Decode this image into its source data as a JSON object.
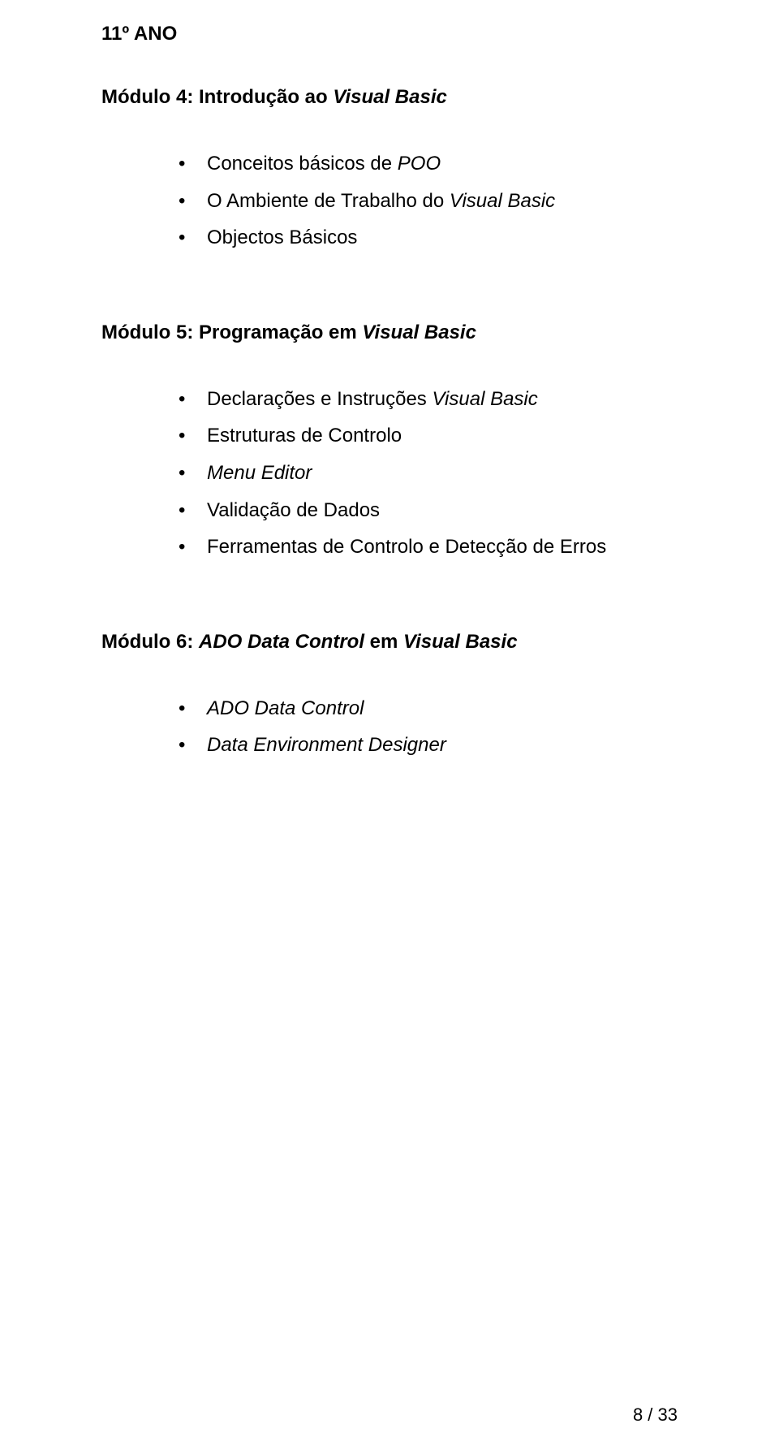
{
  "year_heading": "11º ANO",
  "module4": {
    "title_prefix": "Módulo 4: Introdução ao ",
    "title_italic": "Visual Basic",
    "items": [
      {
        "prefix": "Conceitos básicos de ",
        "italic": "POO"
      },
      {
        "prefix": "O Ambiente de Trabalho do ",
        "italic": "Visual Basic"
      },
      {
        "prefix": "Objectos Básicos",
        "italic": ""
      }
    ]
  },
  "module5": {
    "title_prefix": "Módulo 5: Programação em ",
    "title_italic": "Visual Basic",
    "items": [
      {
        "prefix": "Declarações e Instruções ",
        "italic": "Visual Basic"
      },
      {
        "prefix": "Estruturas de Controlo",
        "italic": ""
      },
      {
        "prefix": "",
        "italic": "Menu Editor"
      },
      {
        "prefix": "Validação de Dados",
        "italic": ""
      },
      {
        "prefix": "Ferramentas de Controlo e Detecção de Erros",
        "italic": ""
      }
    ]
  },
  "module6": {
    "title_prefix": "Módulo 6: ",
    "title_italic": "ADO Data Control",
    "title_suffix": " em ",
    "title_italic2": "Visual Basic",
    "items": [
      {
        "prefix": "",
        "italic": "ADO Data Control"
      },
      {
        "prefix": "",
        "italic": "Data Environment Designer"
      }
    ]
  },
  "page_number": "8 / 33"
}
